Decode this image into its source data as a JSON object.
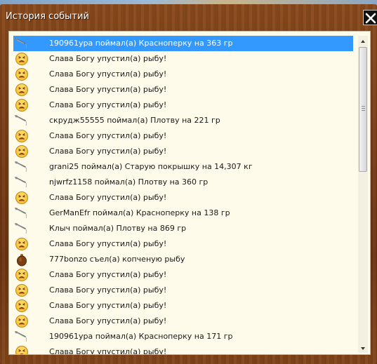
{
  "window": {
    "title": "История событий",
    "close_icon": "close-icon"
  },
  "events": [
    {
      "icon": "fishing-rod-icon",
      "text": "190961ура поймал(а) Красноперку на 363 гр",
      "selected": true
    },
    {
      "icon": "sad-smiley-icon",
      "text": "Слава Богу упустил(а) рыбу!"
    },
    {
      "icon": "sad-smiley-icon",
      "text": "Слава Богу упустил(а) рыбу!"
    },
    {
      "icon": "sad-smiley-icon",
      "text": "Слава Богу упустил(а) рыбу!"
    },
    {
      "icon": "sad-smiley-icon",
      "text": "Слава Богу упустил(а) рыбу!"
    },
    {
      "icon": "fishing-rod-icon",
      "text": "скрудж55555 поймал(а) Плотву на 221 гр"
    },
    {
      "icon": "sad-smiley-icon",
      "text": "Слава Богу упустил(а) рыбу!"
    },
    {
      "icon": "sad-smiley-icon",
      "text": "Слава Богу упустил(а) рыбу!"
    },
    {
      "icon": "fishing-rod-icon",
      "text": "grani25 поймал(а) Старую покрышку на 14,307 кг"
    },
    {
      "icon": "fishing-rod-icon",
      "text": "njwrfz1158 поймал(а) Плотву на 360 гр"
    },
    {
      "icon": "sad-smiley-icon",
      "text": "Слава Богу упустил(а) рыбу!"
    },
    {
      "icon": "fishing-rod-icon",
      "text": "GerManEfr поймал(а) Красноперку на 138 гр"
    },
    {
      "icon": "fishing-rod-icon",
      "text": "Клыч поймал(а) Плотву на 869 гр"
    },
    {
      "icon": "sad-smiley-icon",
      "text": "Слава Богу упустил(а) рыбу!"
    },
    {
      "icon": "bag-icon",
      "text": "777bonzo съел(а) копченую рыбу"
    },
    {
      "icon": "sad-smiley-icon",
      "text": "Слава Богу упустил(а) рыбу!"
    },
    {
      "icon": "sad-smiley-icon",
      "text": "Слава Богу упустил(а) рыбу!"
    },
    {
      "icon": "sad-smiley-icon",
      "text": "Слава Богу упустил(а) рыбу!"
    },
    {
      "icon": "sad-smiley-icon",
      "text": "Слава Богу упустил(а) рыбу!"
    },
    {
      "icon": "fishing-rod-icon",
      "text": "190961ура поймал(а) Красноперку на 171 гр"
    },
    {
      "icon": "sad-smiley-icon",
      "text": "Слава Богу упустил(а) рыбу!"
    }
  ],
  "colors": {
    "selection": "#3399ff",
    "frame_wood": "#7a3e17",
    "panel_bg": "#fefbea"
  }
}
